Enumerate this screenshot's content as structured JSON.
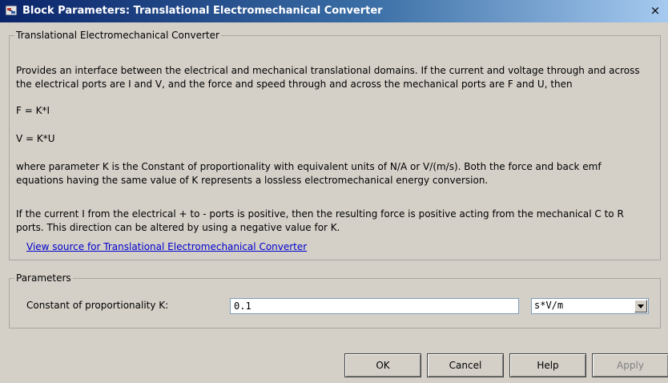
{
  "window": {
    "title": "Block Parameters: Translational Electromechanical Converter",
    "close_glyph": "×"
  },
  "description": {
    "legend": "Translational Electromechanical Converter",
    "intro": "Provides an interface between the electrical and mechanical translational domains. If the current and voltage through and across the electrical ports are I and V, and the force and speed through and across the mechanical ports are F and U, then",
    "equation_1": "F = K*I",
    "equation_2": "V = K*U",
    "paragraph_2": "where parameter K is the Constant of proportionality with equivalent units of N/A or V/(m/s). Both the force and back emf equations having the same value of K represents a lossless electromechanical energy conversion.",
    "paragraph_3": "If the current I from the electrical + to - ports is positive, then the resulting force is positive acting from the mechanical C to R ports. This direction can be altered by using a negative value for K.",
    "source_link": "View source for Translational Electromechanical Converter"
  },
  "parameters": {
    "legend": "Parameters",
    "k_label": "Constant of proportionality K:",
    "k_value": "0.1",
    "unit_value": "s*V/m"
  },
  "buttons": {
    "ok": "OK",
    "cancel": "Cancel",
    "help": "Help",
    "apply": "Apply"
  }
}
